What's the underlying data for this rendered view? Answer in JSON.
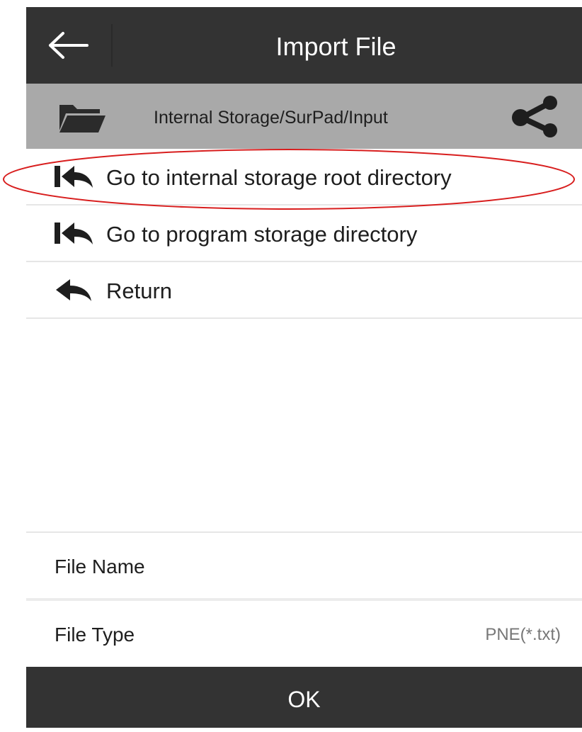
{
  "header": {
    "title": "Import File",
    "back_icon": "arrow-left-icon"
  },
  "pathbar": {
    "folder_icon": "folder-open-icon",
    "path": "Internal Storage/SurPad/Input",
    "share_icon": "share-icon"
  },
  "list": {
    "items": [
      {
        "label": "Go to internal storage root directory",
        "icon": "reply-all-icon",
        "highlighted": true
      },
      {
        "label": "Go to program storage directory",
        "icon": "reply-all-icon"
      },
      {
        "label": "Return",
        "icon": "reply-icon"
      }
    ]
  },
  "form": {
    "file_name_label": "File Name",
    "file_name_value": "",
    "file_type_label": "File Type",
    "file_type_value": "PNE(*.txt)"
  },
  "ok_label": "OK",
  "colors": {
    "header_bg": "#333333",
    "pathbar_bg": "#a9a9a9",
    "highlight_ellipse": "#d81e1e",
    "ok_bg": "#333333"
  }
}
